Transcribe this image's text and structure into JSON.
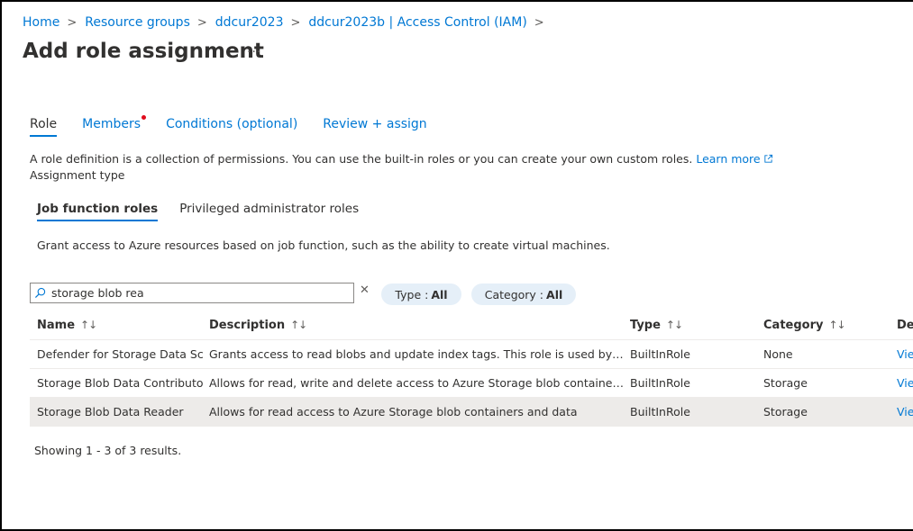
{
  "breadcrumb": {
    "items": [
      "Home",
      "Resource groups",
      "ddcur2023",
      "ddcur2023b | Access Control (IAM)"
    ],
    "separator": ">"
  },
  "page": {
    "title": "Add role assignment",
    "more_label": "···"
  },
  "tabs": [
    {
      "label": "Role",
      "active": true
    },
    {
      "label": "Members",
      "active": false,
      "indicator": true
    },
    {
      "label": "Conditions (optional)",
      "active": false
    },
    {
      "label": "Review + assign",
      "active": false
    }
  ],
  "role_description": {
    "text": "A role definition is a collection of permissions. You can use the built-in roles or you can create your own custom roles.",
    "link": "Learn more"
  },
  "assignment_type_label": "Assignment type",
  "subtabs": [
    {
      "label": "Job function roles",
      "active": true
    },
    {
      "label": "Privileged administrator roles",
      "active": false
    }
  ],
  "subtab_description": "Grant access to Azure resources based on job function, such as the ability to create virtual machines.",
  "search": {
    "value": "storage blob rea",
    "clear_label": "✕"
  },
  "filters": [
    {
      "label": "Type :",
      "value": "All"
    },
    {
      "label": "Category :",
      "value": "All"
    }
  ],
  "table": {
    "columns": [
      {
        "label": "Name",
        "sort": "↑↓"
      },
      {
        "label": "Description",
        "sort": "↑↓"
      },
      {
        "label": "Type",
        "sort": "↑↓"
      },
      {
        "label": "Category",
        "sort": "↑↓"
      },
      {
        "label": "Det",
        "sort": ""
      }
    ],
    "rows": [
      {
        "name": "Defender for Storage Data Sc...",
        "description": "Grants access to read blobs and update index tags. This role is used by the dat...",
        "type": "BuiltInRole",
        "category": "None",
        "details": "Vie",
        "selected": false
      },
      {
        "name": "Storage Blob Data Contributor",
        "description": "Allows for read, write and delete access to Azure Storage blob containers and ...",
        "type": "BuiltInRole",
        "category": "Storage",
        "details": "Vie",
        "selected": false
      },
      {
        "name": "Storage Blob Data Reader",
        "description": "Allows for read access to Azure Storage blob containers and data",
        "type": "BuiltInRole",
        "category": "Storage",
        "details": "Vie",
        "selected": true
      }
    ]
  },
  "results_text": "Showing 1 - 3 of 3 results.",
  "colors": {
    "accent": "#0078d4",
    "indicator": "#e00b1c",
    "pill_bg": "#e5eff8",
    "selected_row": "#edebe9"
  }
}
